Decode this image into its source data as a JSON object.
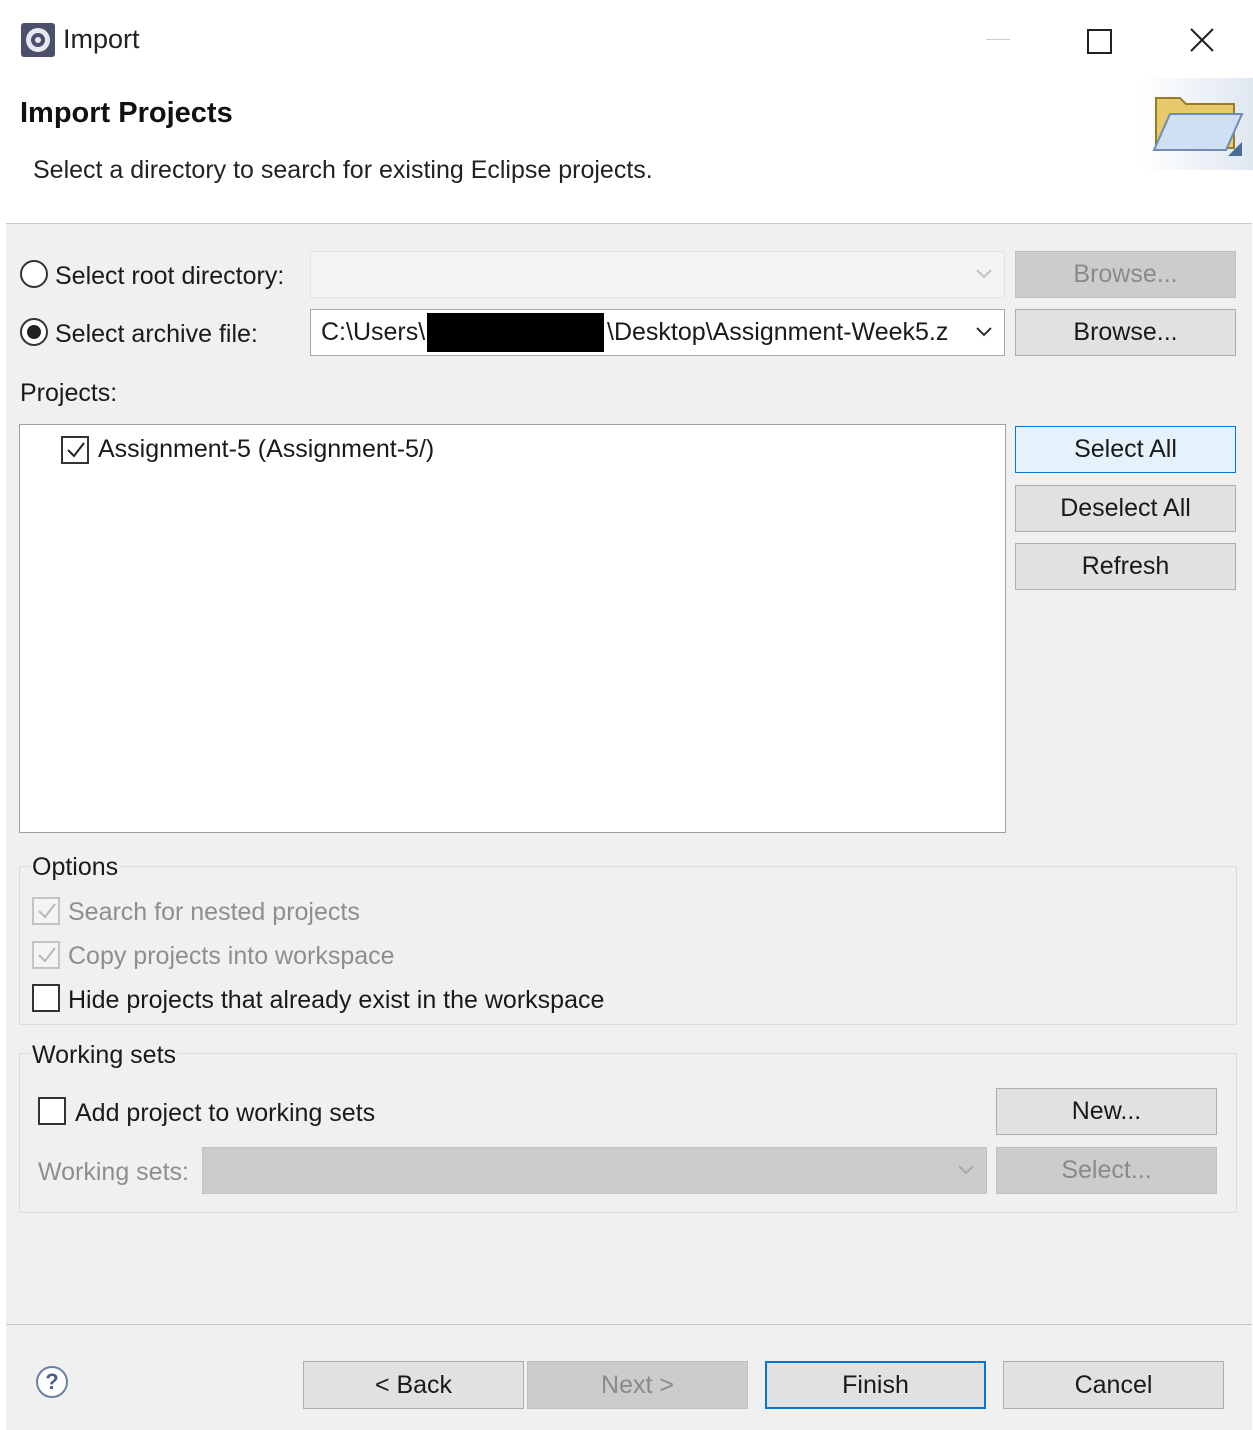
{
  "window": {
    "title": "Import",
    "icon": "eclipse-gear-icon"
  },
  "header": {
    "title": "Import Projects",
    "description": "Select a directory to search for existing Eclipse projects.",
    "icon": "open-folder-icon"
  },
  "source": {
    "root_directory_label": "Select root directory:",
    "root_directory_value": "",
    "root_directory_selected": false,
    "root_browse_label": "Browse...",
    "archive_file_label": "Select archive file:",
    "archive_file_value_prefix": "C:\\Users\\",
    "archive_file_value_suffix": "\\Desktop\\Assignment-Week5.z",
    "archive_file_selected": true,
    "archive_browse_label": "Browse..."
  },
  "projects": {
    "label": "Projects:",
    "items": [
      {
        "label": "Assignment-5 (Assignment-5/)",
        "checked": true
      }
    ],
    "select_all_label": "Select All",
    "deselect_all_label": "Deselect All",
    "refresh_label": "Refresh"
  },
  "options": {
    "title": "Options",
    "search_nested_label": "Search for nested projects",
    "search_nested_checked": true,
    "copy_into_workspace_label": "Copy projects into workspace",
    "copy_into_workspace_checked": true,
    "hide_existing_label": "Hide projects that already exist in the workspace",
    "hide_existing_checked": false
  },
  "working_sets": {
    "title": "Working sets",
    "add_to_working_sets_label": "Add project to working sets",
    "add_to_working_sets_checked": false,
    "new_label": "New...",
    "working_sets_label": "Working sets:",
    "working_sets_value": "",
    "select_label": "Select..."
  },
  "footer": {
    "help_symbol": "?",
    "back_label": "< Back",
    "next_label": "Next >",
    "finish_label": "Finish",
    "cancel_label": "Cancel"
  },
  "colors": {
    "accent": "#0078d7",
    "dialog_background": "#f0f0f0",
    "disabled_text": "#8e8e8e"
  }
}
